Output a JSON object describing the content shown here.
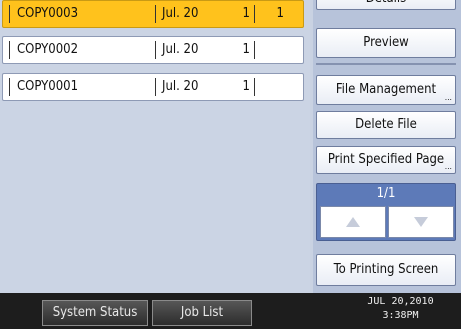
{
  "files": [
    {
      "name": "COPY0003",
      "date": "Jul. 20",
      "qty": "1",
      "qty2": "1",
      "selected": true
    },
    {
      "name": "COPY0002",
      "date": "Jul. 20",
      "qty": "1",
      "qty2": "",
      "selected": false
    },
    {
      "name": "COPY0001",
      "date": "Jul. 20",
      "qty": "1",
      "qty2": "",
      "selected": false
    }
  ],
  "side": {
    "details": "Details",
    "preview": "Preview",
    "file_management": "File Management",
    "delete_file": "Delete File",
    "print_specified_page": "Print Specified Page",
    "page_indicator": "1/1",
    "to_printing_screen": "To Printing Screen"
  },
  "statusbar": {
    "system_status": "System Status",
    "job_list": "Job List",
    "date": "JUL  20,2010",
    "time": "3:38PM"
  },
  "colors": {
    "selected_row": "#ffc21c",
    "pager": "#5d7ab8",
    "statusbar": "#1d1d1d"
  }
}
